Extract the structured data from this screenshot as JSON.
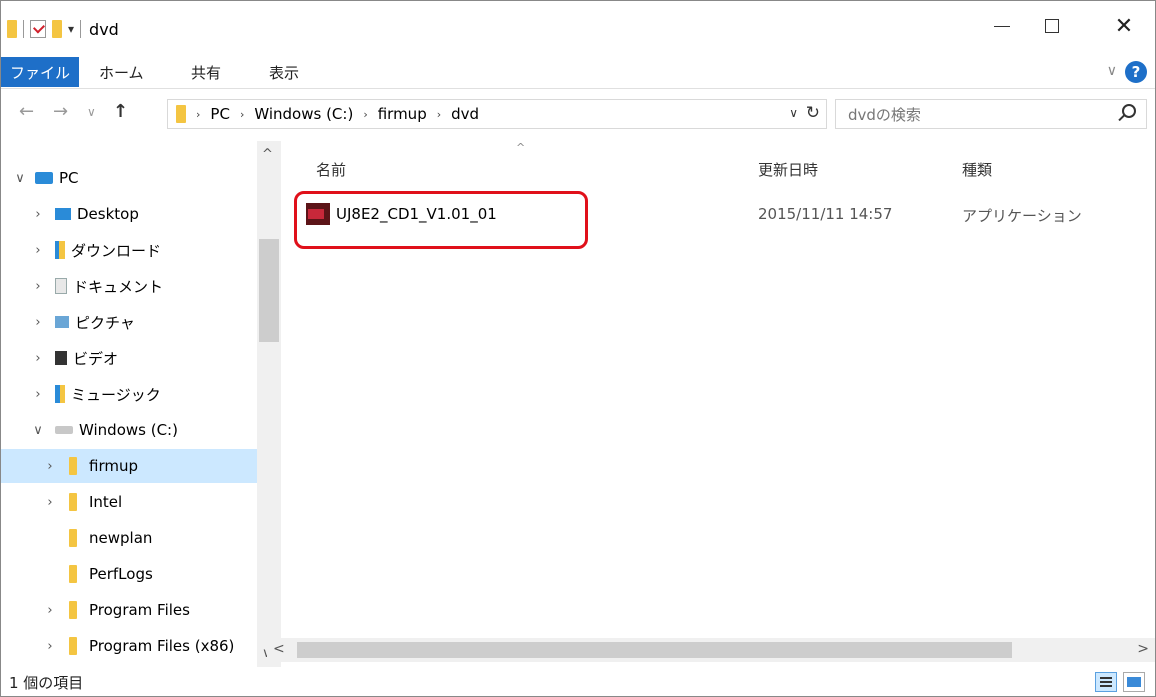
{
  "window": {
    "title": "dvd",
    "qat_dropdown": "▾",
    "minimize": "—",
    "maximize": "□",
    "close": "✕"
  },
  "ribbon": {
    "file_tab": "ファイル",
    "tabs": [
      "ホーム",
      "共有",
      "表示"
    ],
    "expand": "∨",
    "help": "?"
  },
  "navigation": {
    "back": "←",
    "forward": "→",
    "recent": "∨",
    "up": "↑",
    "breadcrumb": [
      "PC",
      "Windows (C:)",
      "firmup",
      "dvd"
    ],
    "breadcrumb_sep": "›",
    "address_dropdown": "∨",
    "refresh": "↻",
    "search_placeholder": "dvdの検索"
  },
  "nav_pane": {
    "items": [
      {
        "label": "PC",
        "chevron": "∨",
        "icon": "pc-icon"
      },
      {
        "label": "Desktop",
        "chevron": "›",
        "icon": "desktop-icon"
      },
      {
        "label": "ダウンロード",
        "chevron": "›",
        "icon": "downloads-icon"
      },
      {
        "label": "ドキュメント",
        "chevron": "›",
        "icon": "documents-icon"
      },
      {
        "label": "ピクチャ",
        "chevron": "›",
        "icon": "pictures-icon"
      },
      {
        "label": "ビデオ",
        "chevron": "›",
        "icon": "videos-icon"
      },
      {
        "label": "ミュージック",
        "chevron": "›",
        "icon": "music-icon"
      },
      {
        "label": "Windows (C:)",
        "chevron": "∨",
        "icon": "drive-icon"
      },
      {
        "label": "firmup",
        "chevron": "›",
        "icon": "folder-icon",
        "selected": true
      },
      {
        "label": "Intel",
        "chevron": "›",
        "icon": "folder-icon"
      },
      {
        "label": "newplan",
        "chevron": "",
        "icon": "folder-icon"
      },
      {
        "label": "PerfLogs",
        "chevron": "",
        "icon": "folder-icon"
      },
      {
        "label": "Program Files",
        "chevron": "›",
        "icon": "folder-icon"
      },
      {
        "label": "Program Files (x86)",
        "chevron": "›",
        "icon": "folder-icon"
      }
    ],
    "scroll_up": "^",
    "scroll_down": "∨"
  },
  "content": {
    "columns": {
      "name": "名前",
      "modified": "更新日時",
      "type": "種類"
    },
    "sort_indicator": "^",
    "files": [
      {
        "name": "UJ8E2_CD1_V1.01_01",
        "modified": "2015/11/11 14:57",
        "type": "アプリケーション",
        "icon": "application-icon"
      }
    ],
    "hscroll_left": "<",
    "hscroll_right": ">"
  },
  "status": {
    "item_count": "1 個の項目"
  },
  "colors": {
    "accent": "#1e6fc8",
    "selection": "#cce8ff",
    "highlight_border": "#e0101a",
    "folder": "#f4c542"
  }
}
